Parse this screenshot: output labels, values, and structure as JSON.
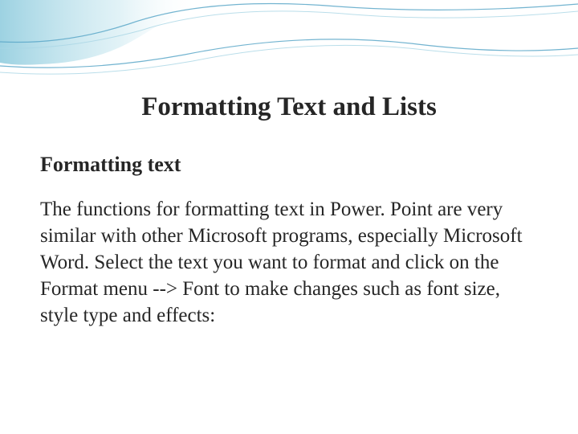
{
  "slide": {
    "title": "Formatting Text and Lists",
    "subheading": "Formatting text",
    "body": "The functions for formatting text in Power. Point are very similar with other Microsoft programs, especially Microsoft Word. Select the text you want to format and click on the Format menu --> Font to make changes such as font size, style type and effects:"
  },
  "theme": {
    "wave_stroke_dark": "#5aa7c8",
    "wave_stroke_light": "#a9d6e5",
    "wave_gradient_start": "#7cc3d8",
    "wave_gradient_end": "#d4ebf2"
  }
}
